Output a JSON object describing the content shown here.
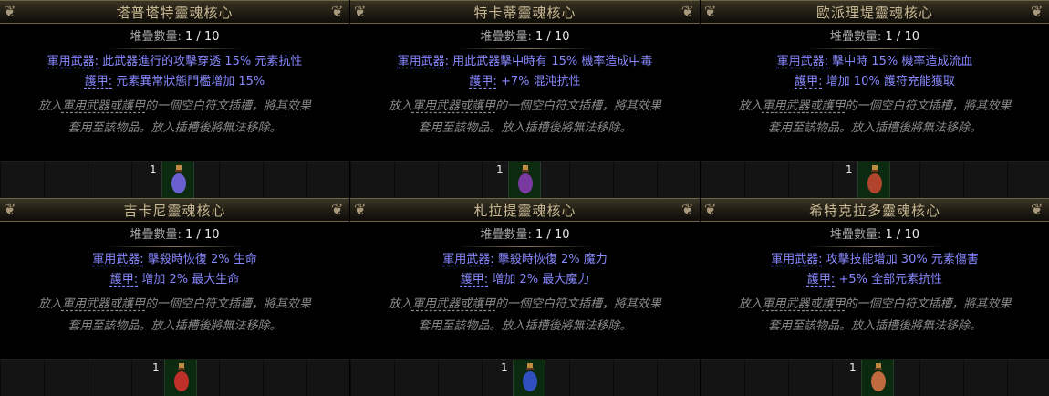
{
  "labels": {
    "stack": "堆疊數量:",
    "weapon": "軍用武器:",
    "armor": "護甲:",
    "desc_line1_pre": "放入",
    "desc_line1_link": "軍用武器或護甲",
    "desc_line1_post": "的一個空白符文插槽，將其效果",
    "desc_line2": "套用至該物品。放入插槽後將無法移除。"
  },
  "items": [
    {
      "title": "塔普塔特靈魂核心",
      "stack": "1 / 10",
      "weapon": "此武器進行的攻擊穿透 15% 元素抗性",
      "armor": "元素異常狀態門檻增加 15%",
      "quantity": "1",
      "flask_color": "#6a5fd0"
    },
    {
      "title": "特卡蒂靈魂核心",
      "stack": "1 / 10",
      "weapon": "用此武器擊中時有 15% 機率造成中毒",
      "armor": "+7% 混沌抗性",
      "quantity": "1",
      "flask_color": "#7a3aa0"
    },
    {
      "title": "歐派理堤靈魂核心",
      "stack": "1 / 10",
      "weapon": "擊中時 15% 機率造成流血",
      "armor": "增加 10% 護符充能獲取",
      "quantity": "1",
      "flask_color": "#b0442c"
    },
    {
      "title": "吉卡尼靈魂核心",
      "stack": "1 / 10",
      "weapon": "擊殺時恢復 2% 生命",
      "armor": "增加 2% 最大生命",
      "quantity": "1",
      "flask_color": "#c0302a"
    },
    {
      "title": "札拉提靈魂核心",
      "stack": "1 / 10",
      "weapon": "擊殺時恢復 2% 魔力",
      "armor": "增加 2% 最大魔力",
      "quantity": "1",
      "flask_color": "#3050c0"
    },
    {
      "title": "希特克拉多靈魂核心",
      "stack": "1 / 10",
      "weapon": "攻擊技能增加 30% 元素傷害",
      "armor": "+5% 全部元素抗性",
      "quantity": "1",
      "flask_color": "#c06a40"
    }
  ]
}
